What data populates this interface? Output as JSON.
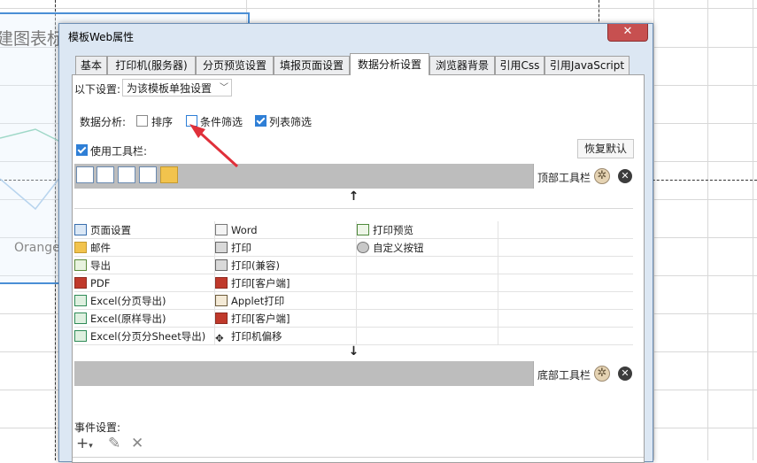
{
  "background": {
    "chart_title": "建图表标",
    "axis_label": "Orange"
  },
  "dialog": {
    "title": "模板Web属性",
    "close_icon": "close-icon"
  },
  "tabs": [
    {
      "label": "基本"
    },
    {
      "label": "打印机(服务器)"
    },
    {
      "label": "分页预览设置"
    },
    {
      "label": "填报页面设置"
    },
    {
      "label": "数据分析设置",
      "active": true
    },
    {
      "label": "浏览器背景"
    },
    {
      "label": "引用Css"
    },
    {
      "label": "引用JavaScript"
    }
  ],
  "settings": {
    "scope_label": "以下设置:",
    "scope_value": "为该模板单独设置",
    "analysis_label": "数据分析:",
    "options": [
      {
        "label": "排序",
        "checked": false
      },
      {
        "label": "条件筛选",
        "checked": false
      },
      {
        "label": "列表筛选",
        "checked": true
      }
    ],
    "use_toolbar_label": "使用工具栏:",
    "use_toolbar_checked": true,
    "restore_label": "恢复默认"
  },
  "toolbars": {
    "top_label": "顶部工具栏",
    "bottom_label": "底部工具栏",
    "top_icons": [
      "page-setup-icon",
      "print-preview-icon",
      "print-icon",
      "export-icon",
      "mail-icon"
    ]
  },
  "buttons_grid": {
    "col1": [
      {
        "label": "页面设置",
        "icon": "page-setup-icon"
      },
      {
        "label": "邮件",
        "icon": "mail-icon"
      },
      {
        "label": "导出",
        "icon": "export-icon"
      },
      {
        "label": "PDF",
        "icon": "pdf-icon"
      },
      {
        "label": "Excel(分页导出)",
        "icon": "excel-icon"
      },
      {
        "label": "Excel(原样导出)",
        "icon": "excel-icon"
      },
      {
        "label": "Excel(分页分Sheet导出)",
        "icon": "excel-icon"
      }
    ],
    "col2": [
      {
        "label": "Word",
        "icon": "word-icon"
      },
      {
        "label": "打印",
        "icon": "print-icon"
      },
      {
        "label": "打印(兼容)",
        "icon": "print-icon"
      },
      {
        "label": "打印[客户端]",
        "icon": "print-client-icon"
      },
      {
        "label": "Applet打印",
        "icon": "applet-print-icon"
      },
      {
        "label": "打印[客户端]",
        "icon": "print-client-icon"
      },
      {
        "label": "打印机偏移",
        "icon": "move-icon"
      }
    ],
    "col3": [
      {
        "label": "打印预览",
        "icon": "print-preview-icon"
      },
      {
        "label": "自定义按钮",
        "icon": "gear-icon"
      }
    ]
  },
  "events": {
    "label": "事件设置:",
    "add": "+",
    "add_caret": "▾",
    "edit": "✎",
    "remove": "✕"
  },
  "colors": {
    "accent": "#2f7fd6",
    "toolbar_bar": "#bdbdbd",
    "annotation_arrow": "#e0303a"
  }
}
